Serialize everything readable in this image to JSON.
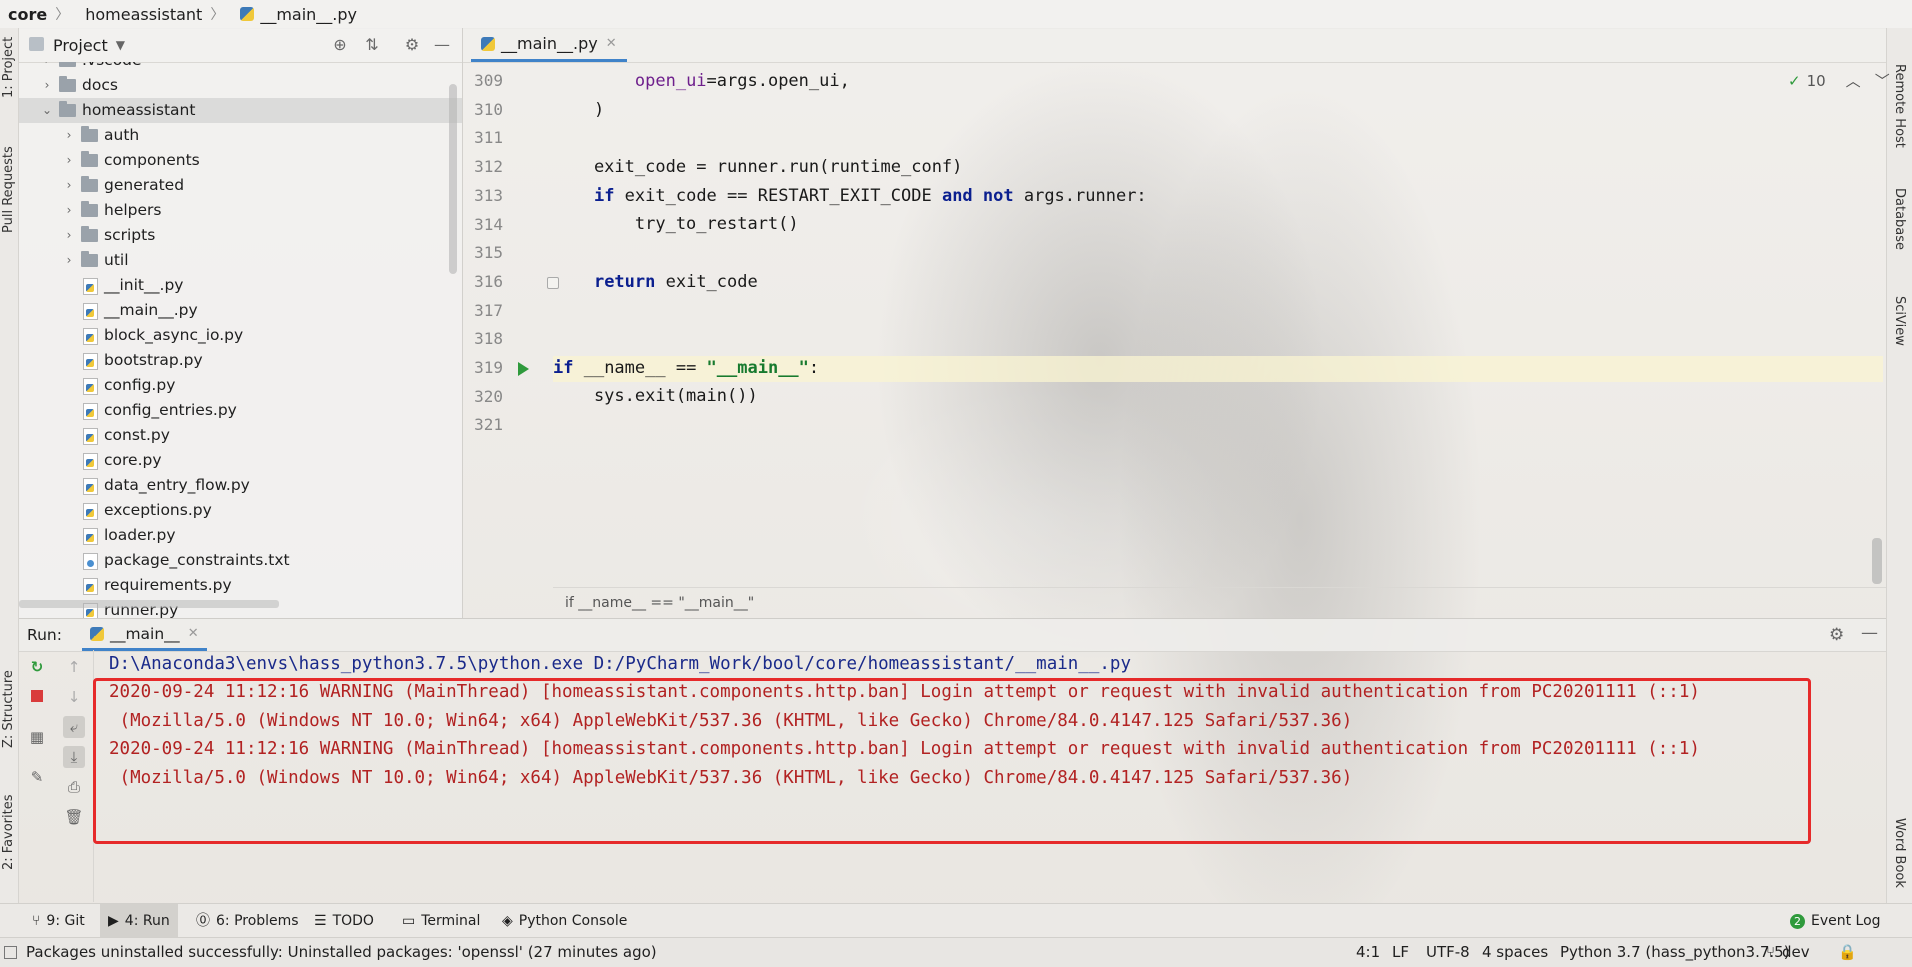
{
  "breadcrumb": {
    "root": "core",
    "folder": "homeassistant",
    "file": "__main__.py"
  },
  "left_stripe": {
    "project": "1: Project",
    "pull_requests": "Pull Requests",
    "structure": "Z: Structure",
    "favorites": "2: Favorites"
  },
  "right_stripe": {
    "remote_host": "Remote Host",
    "database": "Database",
    "sciview": "SciView",
    "word_book": "Word Book"
  },
  "project_panel": {
    "title": "Project",
    "items": [
      {
        "label": ".vscode",
        "kind": "folder",
        "level": 1,
        "expanded": false
      },
      {
        "label": "docs",
        "kind": "folder",
        "level": 1,
        "expanded": false
      },
      {
        "label": "homeassistant",
        "kind": "folder",
        "level": 1,
        "expanded": true,
        "selected": true
      },
      {
        "label": "auth",
        "kind": "folder",
        "level": 2,
        "expanded": false
      },
      {
        "label": "components",
        "kind": "folder",
        "level": 2,
        "expanded": false
      },
      {
        "label": "generated",
        "kind": "folder",
        "level": 2,
        "expanded": false
      },
      {
        "label": "helpers",
        "kind": "folder",
        "level": 2,
        "expanded": false
      },
      {
        "label": "scripts",
        "kind": "folder",
        "level": 2,
        "expanded": false
      },
      {
        "label": "util",
        "kind": "folder",
        "level": 2,
        "expanded": false
      },
      {
        "label": "__init__.py",
        "kind": "py",
        "level": 2
      },
      {
        "label": "__main__.py",
        "kind": "py",
        "level": 2
      },
      {
        "label": "block_async_io.py",
        "kind": "py",
        "level": 2
      },
      {
        "label": "bootstrap.py",
        "kind": "py",
        "level": 2
      },
      {
        "label": "config.py",
        "kind": "py",
        "level": 2
      },
      {
        "label": "config_entries.py",
        "kind": "py",
        "level": 2
      },
      {
        "label": "const.py",
        "kind": "py",
        "level": 2
      },
      {
        "label": "core.py",
        "kind": "py",
        "level": 2
      },
      {
        "label": "data_entry_flow.py",
        "kind": "py",
        "level": 2
      },
      {
        "label": "exceptions.py",
        "kind": "py",
        "level": 2
      },
      {
        "label": "loader.py",
        "kind": "py",
        "level": 2
      },
      {
        "label": "package_constraints.txt",
        "kind": "txt",
        "level": 2
      },
      {
        "label": "requirements.py",
        "kind": "py",
        "level": 2
      },
      {
        "label": "runner.py",
        "kind": "py",
        "level": 2
      }
    ]
  },
  "editor": {
    "tab": "__main__.py",
    "inspections_count": "10",
    "line_numbers": [
      "309",
      "310",
      "311",
      "312",
      "313",
      "314",
      "315",
      "316",
      "317",
      "318",
      "319",
      "320",
      "321"
    ],
    "breadcrumb": "if __name__ == \"__main__\""
  },
  "run_panel": {
    "label": "Run:",
    "tab": "__main__",
    "command": "D:\\Anaconda3\\envs\\hass_python3.7.5\\python.exe D:/PyCharm_Work/bool/core/homeassistant/__main__.py",
    "log_lines": [
      "2020-09-24 11:12:16 WARNING (MainThread) [homeassistant.components.http.ban] Login attempt or request with invalid authentication from PC20201111 (::1)",
      " (Mozilla/5.0 (Windows NT 10.0; Win64; x64) AppleWebKit/537.36 (KHTML, like Gecko) Chrome/84.0.4147.125 Safari/537.36)",
      "2020-09-24 11:12:16 WARNING (MainThread) [homeassistant.components.http.ban] Login attempt or request with invalid authentication from PC20201111 (::1)",
      " (Mozilla/5.0 (Windows NT 10.0; Win64; x64) AppleWebKit/537.36 (KHTML, like Gecko) Chrome/84.0.4147.125 Safari/537.36)"
    ]
  },
  "bottom_bar": {
    "git": "9: Git",
    "run": "4: Run",
    "problems": "6: Problems",
    "todo": "TODO",
    "terminal": "Terminal",
    "python_console": "Python Console",
    "event_log": "Event Log",
    "event_log_count": "2"
  },
  "status_bar": {
    "message": "Packages uninstalled successfully: Uninstalled packages: 'openssl' (27 minutes ago)",
    "position": "4:1",
    "line_sep": "LF",
    "encoding": "UTF-8",
    "indent": "4 spaces",
    "interpreter": "Python 3.7 (hass_python3.7.5)",
    "branch": "dev"
  },
  "colors": {
    "accent": "#4083c9",
    "error_text": "#b22222",
    "error_box": "#e62a2a",
    "keyword": "#0b1f8f",
    "string": "#177a2e",
    "run_green": "#2f9a3c"
  }
}
